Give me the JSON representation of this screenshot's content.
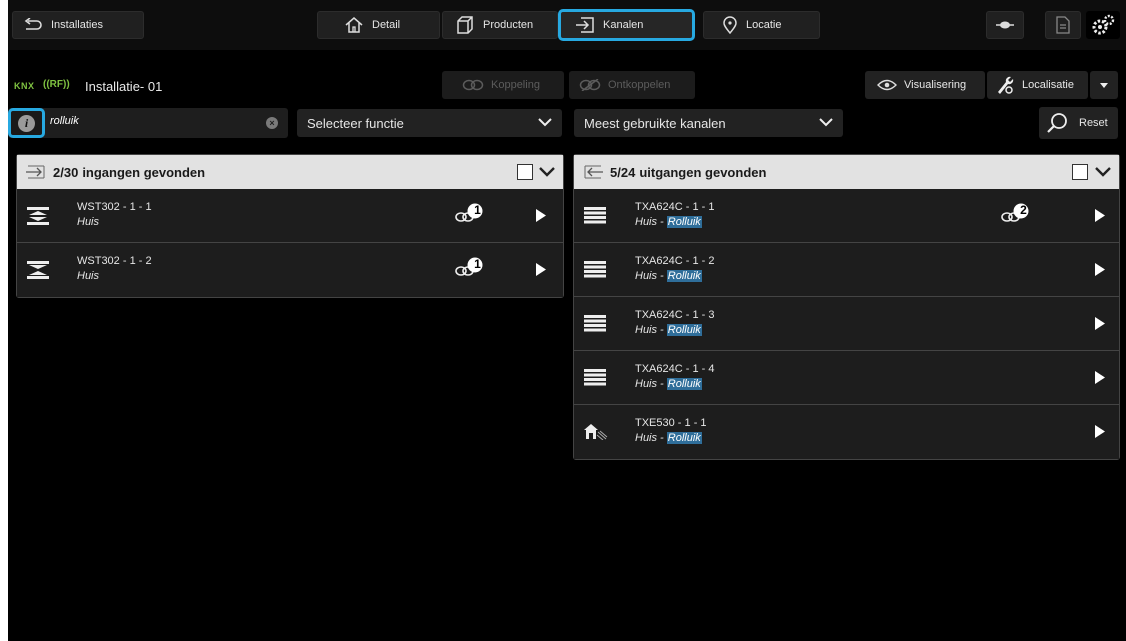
{
  "topbar": {
    "installaties_label": "Installaties",
    "detail_label": "Detail",
    "producten_label": "Producten",
    "kanalen_label": "Kanalen",
    "locatie_label": "Locatie"
  },
  "toolbar": {
    "installation_title": "Installatie- 01",
    "knx_label": "KNX",
    "rf_label": "((RF))",
    "koppeling_label": "Koppeling",
    "ontkoppelen_label": "Ontkoppelen",
    "visualisering_label": "Visualisering",
    "localisatie_label": "Localisatie"
  },
  "filters": {
    "search_value": "rolluik",
    "functie_select": "Selecteer functie",
    "kanalen_select": "Meest gebruikte kanalen",
    "reset_label": "Reset"
  },
  "inputs_panel": {
    "count": "2/30",
    "title": "ingangen gevonden",
    "items": [
      {
        "name": "WST302 - 1 - 1",
        "location": "Huis",
        "links": "1"
      },
      {
        "name": "WST302 - 1 - 2",
        "location": "Huis",
        "links": "1"
      }
    ]
  },
  "outputs_panel": {
    "count": "5/24",
    "title": "uitgangen gevonden",
    "items": [
      {
        "name": "TXA624C - 1 - 1",
        "location": "Huis - ",
        "tag": "Rolluik",
        "links": "2"
      },
      {
        "name": "TXA624C - 1 - 2",
        "location": "Huis - ",
        "tag": "Rolluik"
      },
      {
        "name": "TXA624C - 1 - 3",
        "location": "Huis - ",
        "tag": "Rolluik"
      },
      {
        "name": "TXA624C - 1 - 4",
        "location": "Huis - ",
        "tag": "Rolluik"
      },
      {
        "name": "TXE530 - 1 - 1",
        "location": "Huis - ",
        "tag": "Rolluik"
      }
    ]
  },
  "colors": {
    "accent": "#27a9e1",
    "knx_green": "#7fc241",
    "tag_bg": "#2f6e9a"
  }
}
